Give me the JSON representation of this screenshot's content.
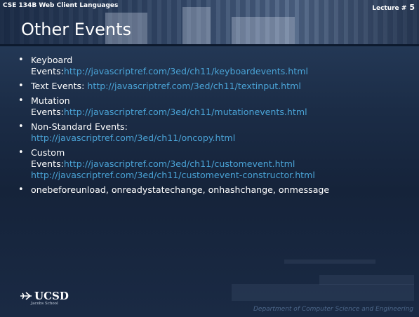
{
  "header": {
    "course": "CSE 134B  Web Client Languages",
    "lecture_label": "Lecture #",
    "lecture_number": "5",
    "title": "Other Events"
  },
  "bullets": [
    {
      "label": "Keyboard",
      "label2": "Events:",
      "links": [
        "http://javascriptref.com/3ed/ch11/keyboardevents.html"
      ]
    },
    {
      "label": "Text Events: ",
      "links": [
        "http://javascriptref.com/3ed/ch11/textinput.html"
      ]
    },
    {
      "label": "Mutation",
      "label2": "Events:",
      "links": [
        "http://javascriptref.com/3ed/ch11/mutationevents.html"
      ]
    },
    {
      "label": "Non-Standard Events:",
      "links": [
        "http://javascriptref.com/3ed/ch11/oncopy.html"
      ]
    },
    {
      "label": "Custom",
      "label2": "Events:",
      "links": [
        "http://javascriptref.com/3ed/ch11/customevent.html",
        "http://javascriptref.com/3ed/ch11/customevent-constructor.html"
      ]
    },
    {
      "label": "onebeforeunload, onreadystatechange, onhashchange, onmessage"
    }
  ],
  "logo": {
    "text": "UCSD",
    "subtext": "Jacobs School",
    "icon": "ucsd-trident-icon"
  },
  "footer": "Department of Computer Science and Engineering",
  "colors": {
    "link": "#4aa3d6",
    "background": "#1b2c46",
    "footer": "#4d6789"
  }
}
